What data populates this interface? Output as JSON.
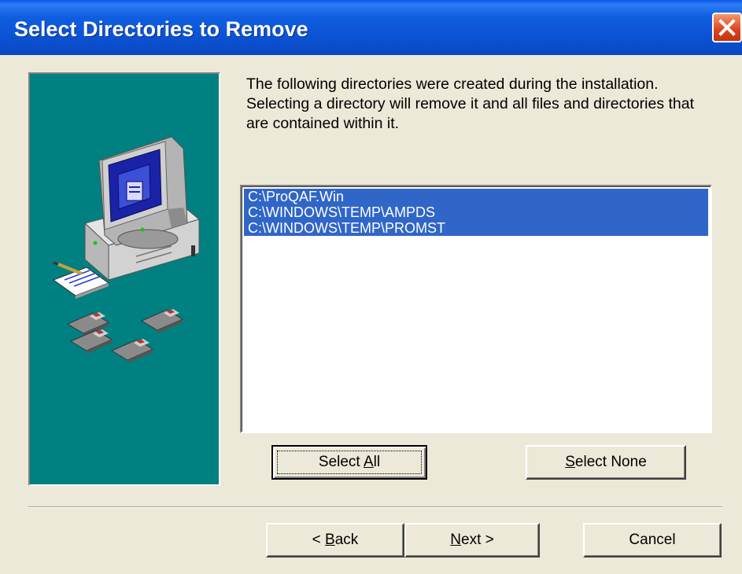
{
  "window": {
    "title": "Select Directories to Remove"
  },
  "description": "The following directories were created during the installation. Selecting a directory will remove it and all files and directories that are contained within it.",
  "directories": [
    {
      "path": "C:\\ProQAF.Win",
      "selected": true
    },
    {
      "path": "C:\\WINDOWS\\TEMP\\AMPDS",
      "selected": true
    },
    {
      "path": "C:\\WINDOWS\\TEMP\\PROMST",
      "selected": true
    }
  ],
  "buttons": {
    "select_all": {
      "pre": "Select ",
      "mnemonic": "A",
      "post": "ll"
    },
    "select_none": {
      "pre": "",
      "mnemonic": "S",
      "post": "elect None"
    },
    "back": {
      "pre": "< ",
      "mnemonic": "B",
      "post": "ack"
    },
    "next": {
      "pre": "",
      "mnemonic": "N",
      "post": "ext >"
    },
    "cancel": "Cancel"
  },
  "colors": {
    "titlebar": "#0b52d3",
    "side_panel": "#008080",
    "selection": "#3066c8",
    "dialog_bg": "#ece9d8"
  },
  "icons": [
    "close-icon",
    "computer-icon",
    "notepad-icon",
    "floppy-disk-icon"
  ]
}
